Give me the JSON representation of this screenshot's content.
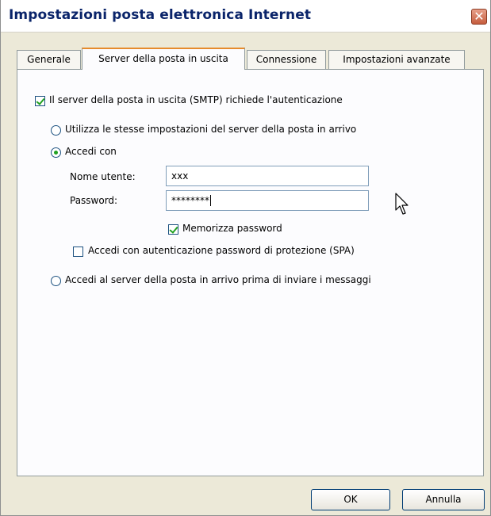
{
  "window": {
    "title": "Impostazioni posta elettronica Internet",
    "close_glyph": "✕"
  },
  "tabs": [
    {
      "label": "Generale",
      "active": false
    },
    {
      "label": "Server della posta in uscita",
      "active": true
    },
    {
      "label": "Connessione",
      "active": false
    },
    {
      "label": "Impostazioni avanzate",
      "active": false
    }
  ],
  "panel": {
    "smtp_auth_label": "Il server della posta in uscita (SMTP) richiede l'autenticazione",
    "smtp_auth_checked": true,
    "radio_same_settings_label": "Utilizza le stesse impostazioni del server della posta in arrivo",
    "radio_login_label": "Accedi con",
    "username_label": "Nome utente:",
    "username_value": "xxx",
    "password_label": "Password:",
    "password_value": "********",
    "remember_password_label": "Memorizza password",
    "remember_password_checked": true,
    "spa_label": "Accedi con autenticazione password di protezione (SPA)",
    "spa_checked": false,
    "radio_incoming_first_label": "Accedi al server della posta in arrivo prima di inviare i messaggi"
  },
  "buttons": {
    "ok_label": "OK",
    "cancel_label": "Annulla"
  },
  "colors": {
    "title_text": "#0a246a",
    "active_tab_accent": "#e68b2c",
    "check_green": "#21a121",
    "close_button": "#c65d3e"
  }
}
